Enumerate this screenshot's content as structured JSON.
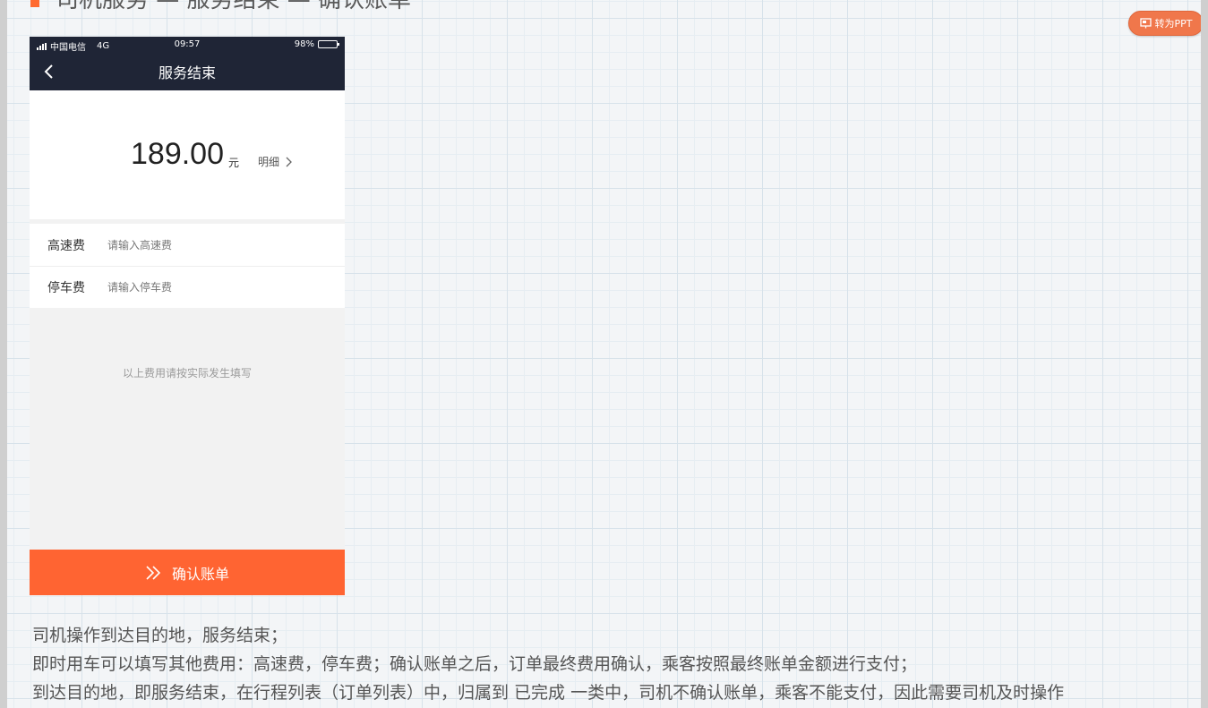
{
  "page": {
    "heading_text": "司机服务 — 服务结束 — 确认账单",
    "ppt_button_label": "转为PPT",
    "accent_color": "#ff6432"
  },
  "phone": {
    "status_bar": {
      "carrier": "中国电信",
      "network": "4G",
      "time": "09:57",
      "battery": "98%",
      "battery_level": 0.98
    },
    "nav": {
      "title": "服务结束",
      "back_icon": "chevron-left-icon"
    },
    "amount": {
      "value": "189.00",
      "unit": "元",
      "detail_label": "明细",
      "detail_icon": "chevron-right-icon"
    },
    "fees": [
      {
        "label": "高速费",
        "value": "",
        "placeholder": "请输入高速费"
      },
      {
        "label": "停车费",
        "value": "",
        "placeholder": "请输入停车费"
      }
    ],
    "hint": "以上费用请按实际发生填写",
    "confirm_button": {
      "label": "确认账单",
      "icon": "double-chevron-right-icon"
    }
  },
  "description": [
    "司机操作到达目的地，服务结束；",
    "即时用车可以填写其他费用：高速费，停车费；确认账单之后，订单最终费用确认，乘客按照最终账单金额进行支付；",
    "到达目的地，即服务结束，在行程列表（订单列表）中，归属到 已完成 一类中，司机不确认账单，乘客不能支付，因此需要司机及时操作"
  ]
}
